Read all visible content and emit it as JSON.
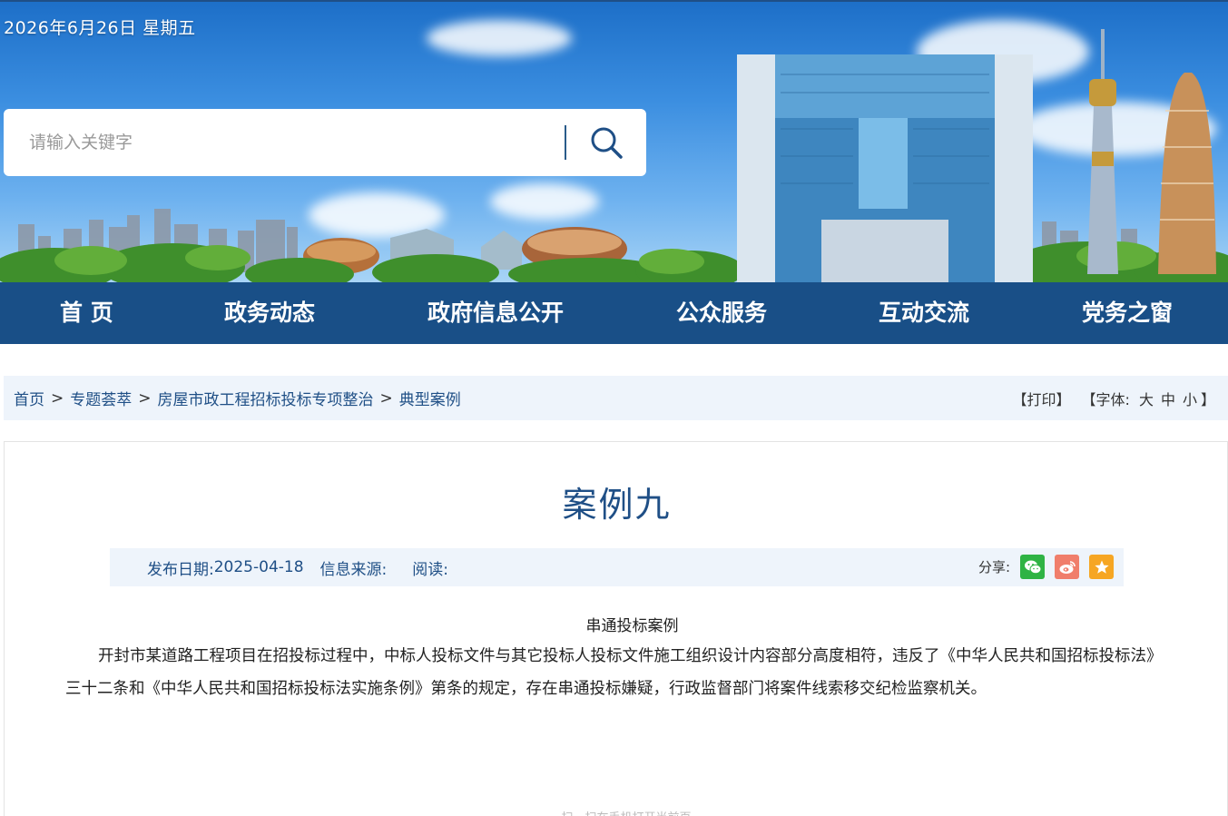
{
  "header": {
    "date": "2026年6月26日 星期五",
    "search": {
      "placeholder": "请输入关键字"
    }
  },
  "nav": {
    "items": [
      {
        "label": "首 页"
      },
      {
        "label": "政务动态"
      },
      {
        "label": "政府信息公开"
      },
      {
        "label": "公众服务"
      },
      {
        "label": "互动交流"
      },
      {
        "label": "党务之窗"
      }
    ]
  },
  "breadcrumb": {
    "items": [
      "首页",
      "专题荟萃",
      "房屋市政工程招标投标专项整治",
      "典型案例"
    ],
    "separator": ">"
  },
  "tools": {
    "print": "【打印】",
    "font_label": "【字体:",
    "font_large": "大",
    "font_medium": "中",
    "font_small": "小",
    "font_close": "】"
  },
  "article": {
    "title": "案例九",
    "date_label": "发布日期:",
    "date_value": "2025-04-18",
    "source_label": "信息来源:",
    "read_label": "阅读:",
    "share_label": "分享:",
    "subhead": "串通投标案例",
    "body": "开封市某道路工程项目在招投标过程中，中标人投标文件与其它投标人投标文件施工组织设计内容部分高度相符，违反了《中华人民共和国招标投标法》三十二条和《中华人民共和国招标投标法实施条例》第条的规定，存在串通投标嫌疑，行政监督部门将案件线索移交纪检监察机关。",
    "footer_hint": "扫一扫在手机打开当前页"
  },
  "share_buttons": [
    {
      "icon": "wechat-icon",
      "color": "#2fb344"
    },
    {
      "icon": "weibo-icon",
      "color": "#f07e6b"
    },
    {
      "icon": "favorite-star-icon",
      "color": "#f6a623"
    }
  ],
  "colors": {
    "nav_bg": "#194f87",
    "accent": "#1f4f86",
    "light_bg": "#eef4fb"
  }
}
